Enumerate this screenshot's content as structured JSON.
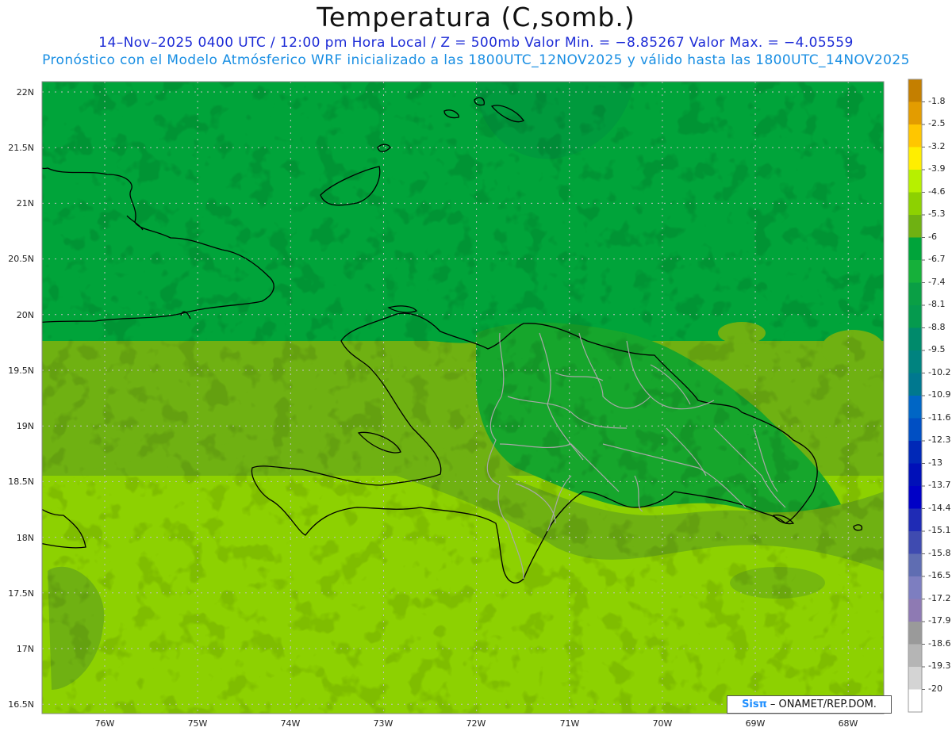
{
  "title": "Temperatura (C,somb.)",
  "subtitle_line1": "14–Nov–2025  0400 UTC / 12:00 pm Hora Local / Z = 500mb  Valor Min. = −8.85267  Valor Max. = −4.05559",
  "subtitle_line2": "Pronóstico con el Modelo Atmósferico WRF inicializado a las 1800UTC_12NOV2025 y válido hasta las  1800UTC_14NOV2025",
  "colors": {
    "background": "#ffffff",
    "title": "#111111",
    "subtitle_line1": "#1c2bd6",
    "subtitle_line2": "#1a8fe3",
    "coastline": "#000000",
    "provinces": "#a8a8a8",
    "gridlines": "#bfbfbf"
  },
  "map": {
    "lat_labels": [
      "22N",
      "21.5N",
      "21N",
      "20.5N",
      "20N",
      "19.5N",
      "19N",
      "18.5N",
      "18N",
      "17.5N",
      "17N",
      "16.5N"
    ],
    "lon_labels": [
      "76W",
      "75W",
      "74W",
      "73W",
      "72W",
      "71W",
      "70W",
      "69W",
      "68W"
    ],
    "field_colors": {
      "north_band": "#00a43a",
      "northeast_darker": "#00963f",
      "central_band": "#6fb112",
      "south_band": "#8dd101",
      "dr_interior": "#16a62c"
    }
  },
  "colorbar": {
    "levels": [
      "-1.8",
      "-2.5",
      "-3.2",
      "-3.9",
      "-4.6",
      "-5.3",
      "-6",
      "-6.7",
      "-7.4",
      "-8.1",
      "-8.8",
      "-9.5",
      "-10.2",
      "-10.9",
      "-11.6",
      "-12.3",
      "-13",
      "-13.7",
      "-14.4",
      "-15.1",
      "-15.8",
      "-16.5",
      "-17.2",
      "-17.9",
      "-18.6",
      "-19.3",
      "-20"
    ],
    "swatches": [
      "#c47f00",
      "#e39c00",
      "#ffc600",
      "#ffee00",
      "#b7f000",
      "#8dd101",
      "#6fb112",
      "#00a43a",
      "#16b03a",
      "#0a9f45",
      "#059a4e",
      "#008a6b",
      "#00837f",
      "#00788f",
      "#0066c5",
      "#004fc3",
      "#0028b7",
      "#0010b8",
      "#0000c6",
      "#1f2bb5",
      "#3f4bb0",
      "#5f6db2",
      "#7d7ec0",
      "#8e7ab3",
      "#9a9a9a",
      "#b5b5b5",
      "#d4d4d4",
      "#ffffff"
    ]
  },
  "credit": {
    "brand": "Sisπ",
    "text": "– ONAMET/REP.DOM."
  }
}
